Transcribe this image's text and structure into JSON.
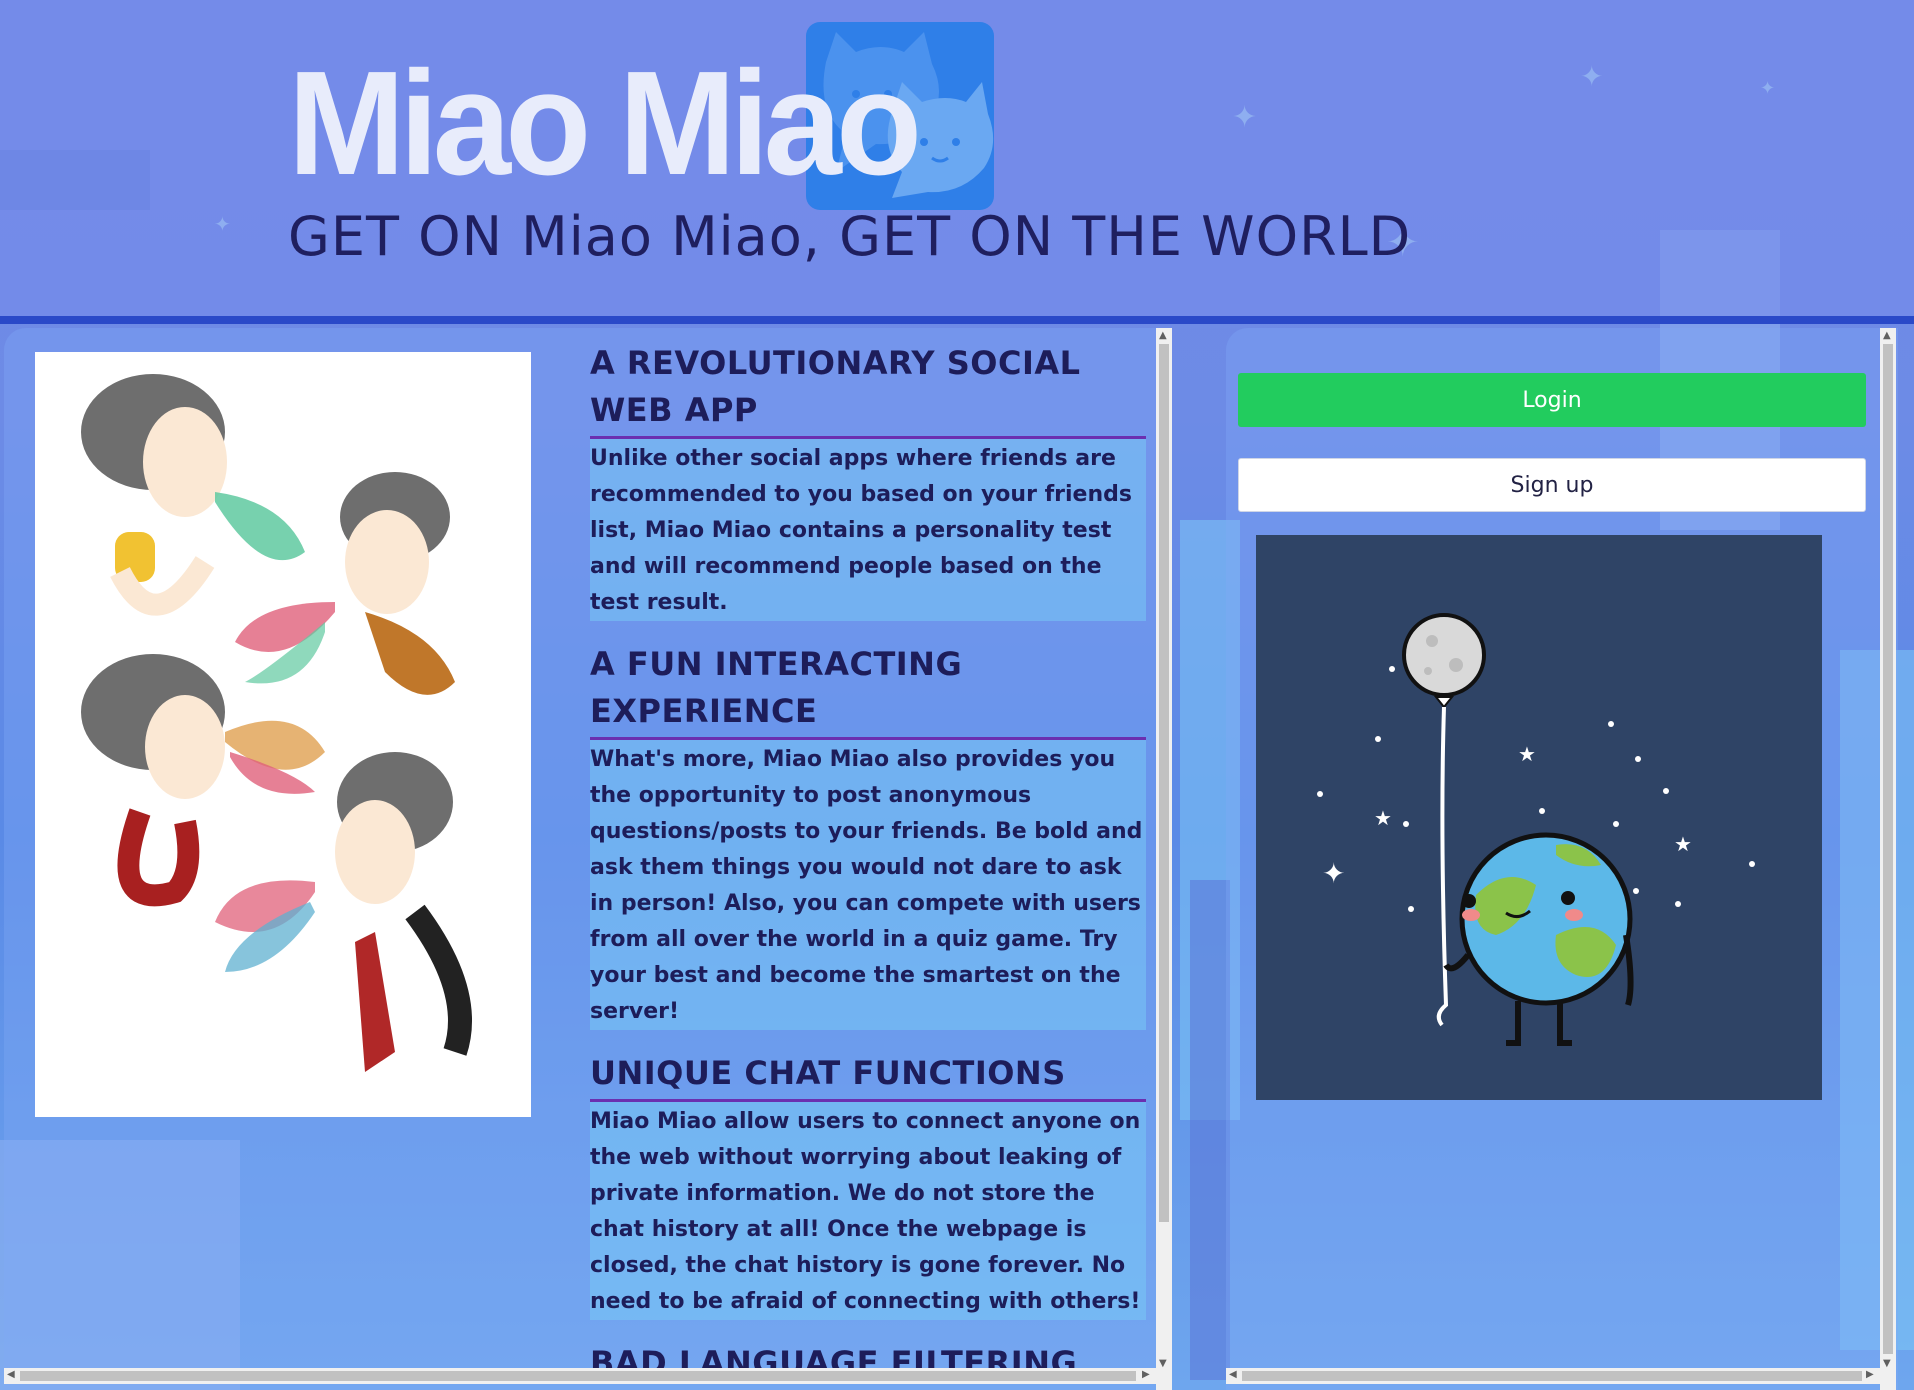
{
  "header": {
    "logo_text": "Miao Miao",
    "tagline": "GET ON Miao Miao, GET ON THE WORLD"
  },
  "sections": [
    {
      "title": "A REVOLUTIONARY SOCIAL WEB APP",
      "body": "Unlike other social apps where friends are recommended to you based on your friends list, Miao Miao contains a personality test and will recommend people based on the test result."
    },
    {
      "title": "A FUN INTERACTING EXPERIENCE",
      "body": "What's more, Miao Miao also provides you the opportunity to post anonymous questions/posts to your friends. Be bold and ask them things you would not dare to ask in person! Also, you can compete with users from all over the world in a quiz game. Try your best and become the smartest on the server!"
    },
    {
      "title": "UNIQUE CHAT FUNCTIONS",
      "body": "Miao Miao allow users to connect anyone on the web without worrying about leaking of private information. We do not store the chat history at all! Once the webpage is closed, the chat history is gone forever. No need to be afraid of connecting with others!"
    },
    {
      "title": "BAD LANGUAGE FILTERING SYSTEM",
      "body": ""
    }
  ],
  "auth": {
    "login_label": "Login",
    "signup_label": "Sign up"
  },
  "icons": {
    "logo": "cat-chat-logo-icon",
    "illustration_left": "people-talking-illustration",
    "illustration_right": "earth-moon-balloon-illustration"
  },
  "colors": {
    "login_bg": "#22cc5e",
    "logo_box": "#2f7fe8",
    "heading": "#1d1d5a",
    "heading_rule": "#6b2fb0"
  }
}
